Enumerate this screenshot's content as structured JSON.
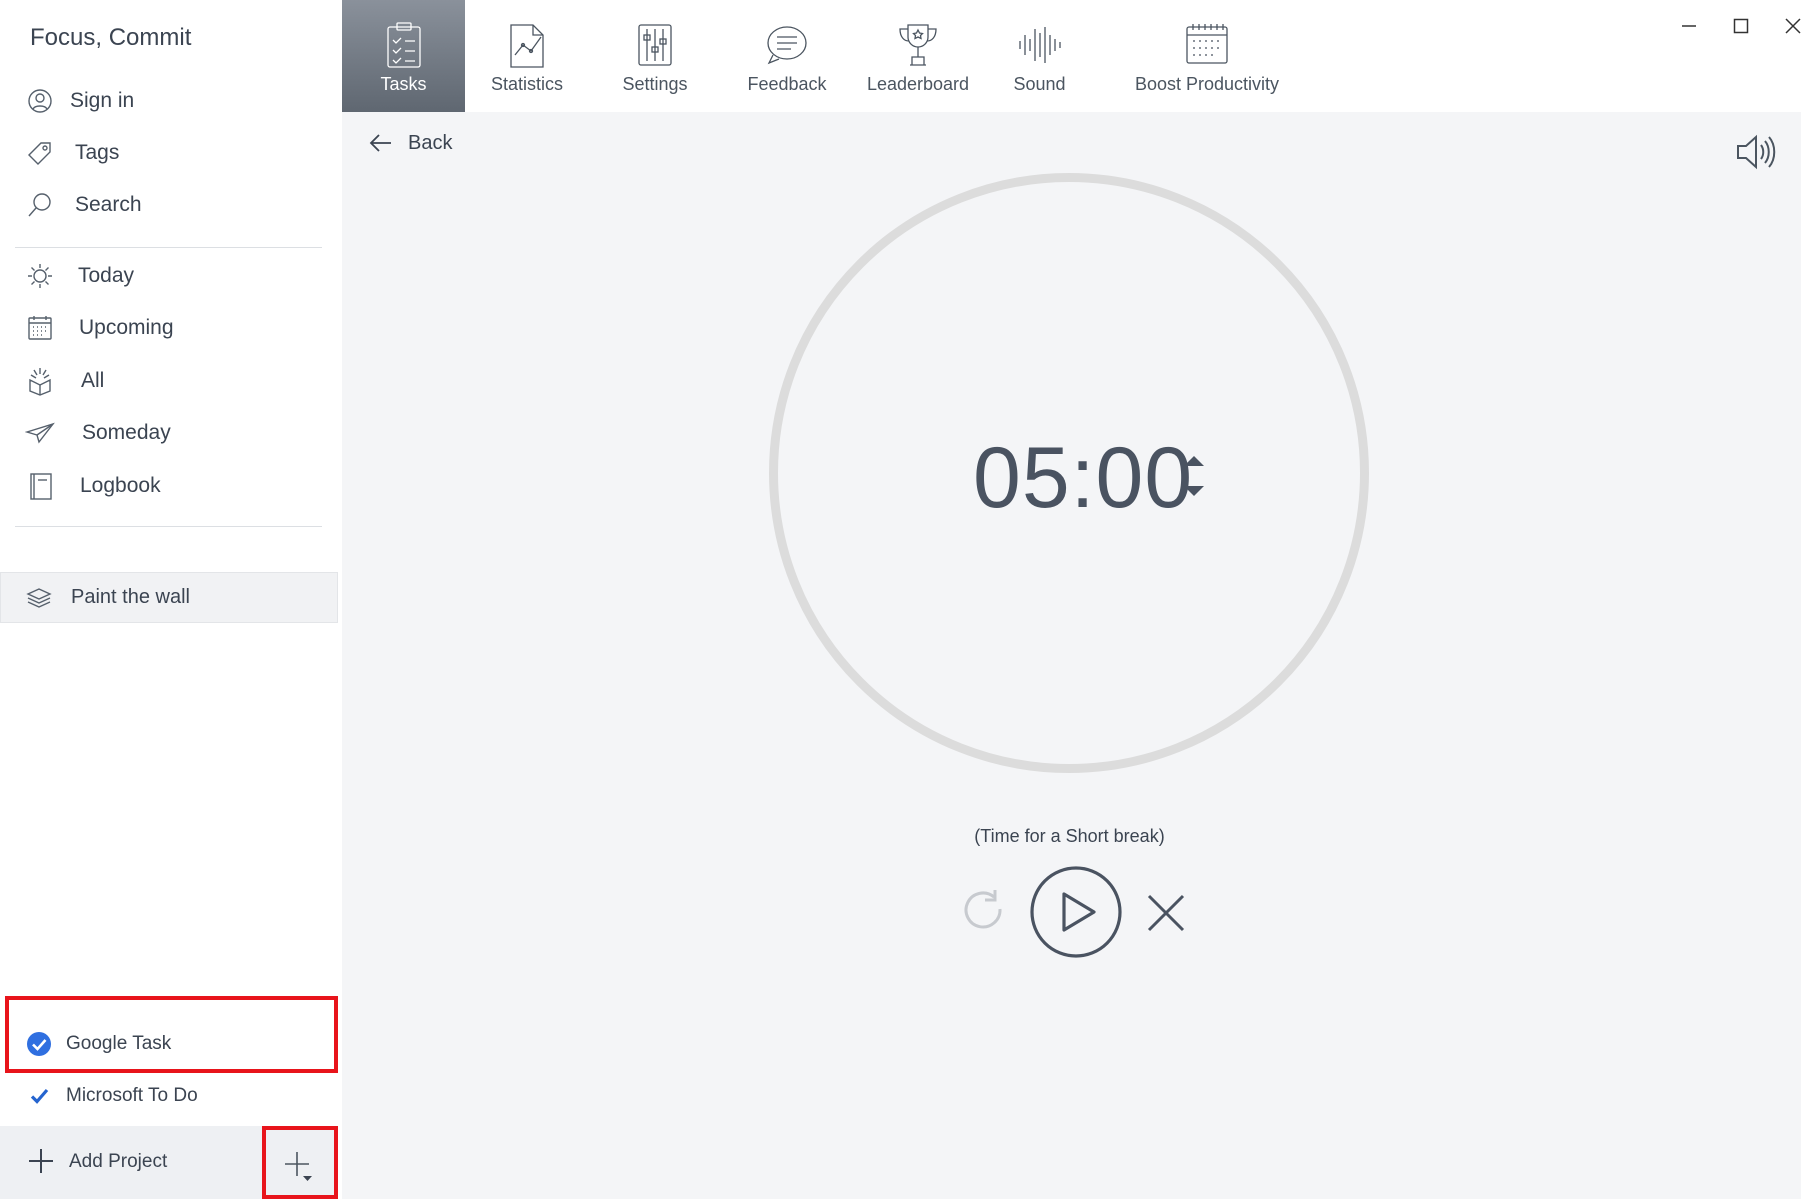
{
  "sidebar": {
    "app_title": "Focus, Commit",
    "account": [
      {
        "label": "Sign in",
        "icon": "user-icon"
      },
      {
        "label": "Tags",
        "icon": "tag-icon"
      },
      {
        "label": "Search",
        "icon": "search-icon"
      }
    ],
    "views": [
      {
        "label": "Today",
        "icon": "sun-icon"
      },
      {
        "label": "Upcoming",
        "icon": "calendar-icon"
      },
      {
        "label": "All",
        "icon": "stack-icon"
      },
      {
        "label": "Someday",
        "icon": "paper-plane-icon"
      },
      {
        "label": "Logbook",
        "icon": "book-icon"
      }
    ],
    "project": {
      "label": "Paint the wall",
      "icon": "layers-icon"
    },
    "integrations": [
      {
        "label": "Google Task",
        "icon": "google-task-check-icon",
        "highlighted": true
      },
      {
        "label": "Microsoft To Do",
        "icon": "microsoft-todo-check-icon",
        "highlighted": false
      }
    ],
    "add_project_label": "Add Project"
  },
  "toolbar": {
    "tabs": [
      {
        "label": "Tasks",
        "icon": "clipboard-icon",
        "active": true
      },
      {
        "label": "Statistics",
        "icon": "chart-icon",
        "active": false
      },
      {
        "label": "Settings",
        "icon": "sliders-icon",
        "active": false
      },
      {
        "label": "Feedback",
        "icon": "feedback-icon",
        "active": false
      },
      {
        "label": "Leaderboard",
        "icon": "trophy-icon",
        "active": false
      },
      {
        "label": "Sound",
        "icon": "waveform-icon",
        "active": false
      },
      {
        "label": "Boost Productivity",
        "icon": "calendar-grid-icon",
        "active": false
      }
    ]
  },
  "main": {
    "back_label": "Back",
    "timer_value": "05:00",
    "status_text": "(Time for a Short break)"
  },
  "colors": {
    "accent_highlight": "#e8141b",
    "active_tab": "#6b737d",
    "google_blue": "#2f6fe0",
    "microsoft_blue": "#2564cf",
    "ring": "#dcdcdc"
  }
}
